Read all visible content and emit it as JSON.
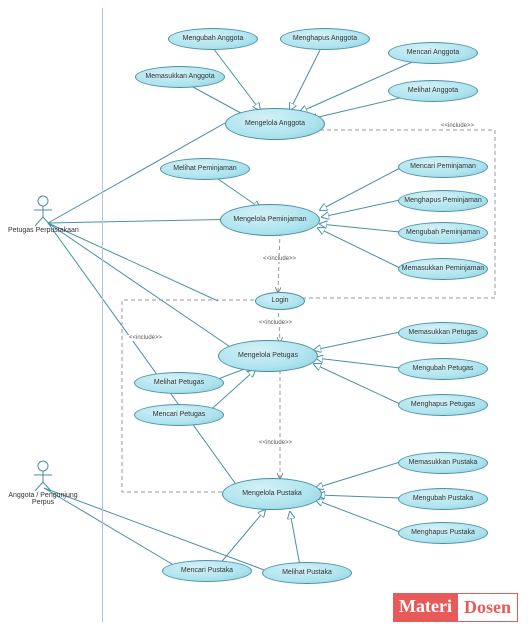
{
  "actors": {
    "petugas": "Petugas Perpustakaan",
    "anggota": "Anggota / Pengunjung Perpus"
  },
  "usecases": {
    "mengelola_anggota": "Mengelola Anggota",
    "mengubah_anggota": "Mengubah Anggota",
    "menghapus_anggota": "Menghapus Anggota",
    "mencari_anggota": "Mencari Anggota",
    "melihat_anggota": "Melihat Anggota",
    "memasukkan_anggota": "Memasukkan Anggota",
    "mengelola_peminjaman": "Mengelola Peminjaman",
    "melihat_peminjaman": "Melihat Peminjaman",
    "mencari_peminjaman": "Mencari Peminjaman",
    "menghapus_peminjaman": "Menghapus Peminjaman",
    "mengubah_peminjaman": "Mengubah Peminjaman",
    "memasukkan_peminjaman": "Memasukkan Peminjaman",
    "login": "Login",
    "mengelola_petugas": "Mengelola Petugas",
    "memasukkan_petugas": "Memasukkan Petugas",
    "mengubah_petugas": "Mengubah Petugas",
    "menghapus_petugas": "Menghapus Petugas",
    "melihat_petugas": "Melihat Petugas",
    "mencari_petugas": "Mencari Petugas",
    "mengelola_pustaka": "Mengelola Pustaka",
    "memasukkan_pustaka": "Memasukkan Pustaka",
    "mengubah_pustaka": "Mengubah Pustaka",
    "menghapus_pustaka": "Menghapus Pustaka",
    "mencari_pustaka": "Mencari Pustaka",
    "melihat_pustaka": "Melihat Pustaka"
  },
  "labels": {
    "include": "<<include>>"
  },
  "watermark": {
    "part1": "Materi",
    "part2": "Dosen"
  }
}
